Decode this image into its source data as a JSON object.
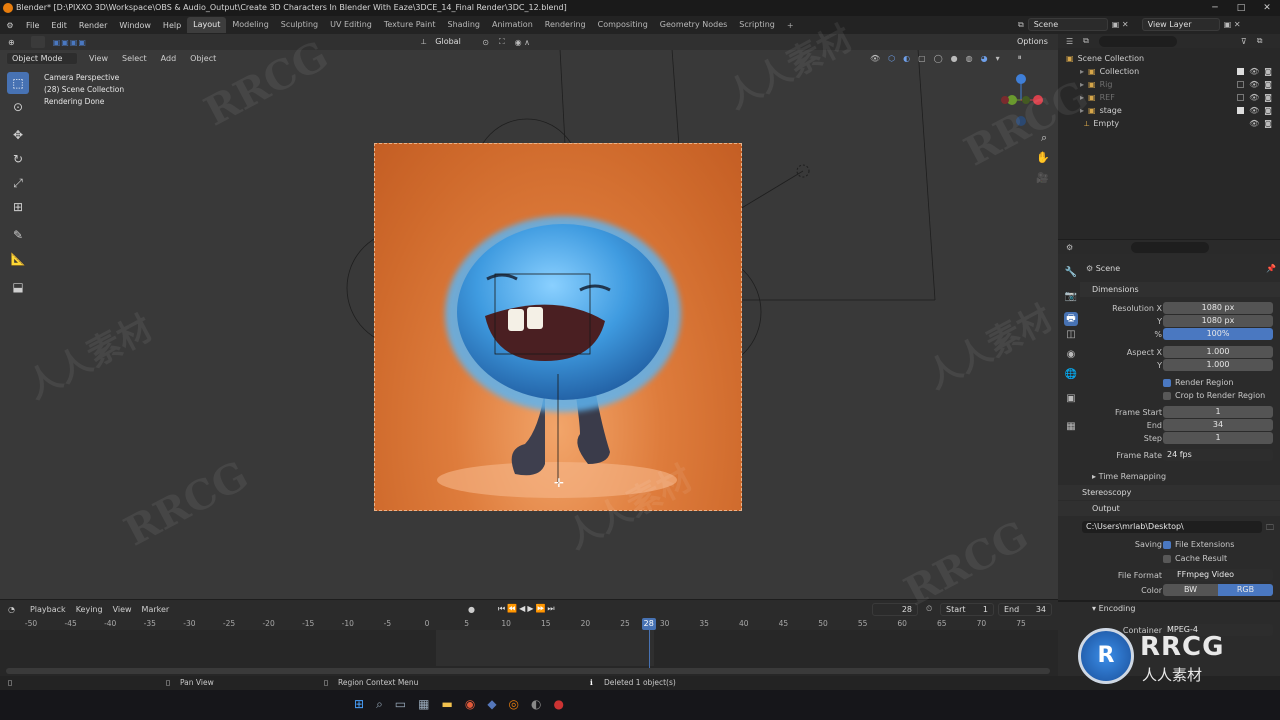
{
  "window": {
    "title": "Blender* [D:\\PIXXO 3D\\Workspace\\OBS & Audio_Output\\Create 3D Characters In Blender With Eaze\\3DCE_14_Final Render\\3DC_12.blend]"
  },
  "menu": [
    "File",
    "Edit",
    "Render",
    "Window",
    "Help"
  ],
  "workspaces": [
    "Layout",
    "Modeling",
    "Sculpting",
    "UV Editing",
    "Texture Paint",
    "Shading",
    "Animation",
    "Rendering",
    "Compositing",
    "Geometry Nodes",
    "Scripting"
  ],
  "scene_name": "Scene",
  "view_layer": "View Layer",
  "viewport": {
    "transform": "Global",
    "options": "Options",
    "mode": "Object Mode",
    "menus": [
      "View",
      "Select",
      "Add",
      "Object"
    ],
    "overlay_lines": [
      "Camera Perspective",
      "(28) Scene Collection",
      "Rendering Done"
    ]
  },
  "outliner": {
    "root": "Scene Collection",
    "items": [
      {
        "label": "Collection",
        "dim": false
      },
      {
        "label": "Rig",
        "dim": true
      },
      {
        "label": "REF",
        "dim": true
      },
      {
        "label": "stage",
        "dim": false
      },
      {
        "label": "Empty",
        "dim": false
      }
    ]
  },
  "properties": {
    "context": "Scene",
    "dimensions": "Dimensions",
    "res_x_label": "Resolution X",
    "res_x": "1080 px",
    "res_y_label": "Y",
    "res_y": "1080 px",
    "pct_label": "%",
    "pct": "100%",
    "aspect_x_label": "Aspect X",
    "aspect_x": "1.000",
    "aspect_y_label": "Y",
    "aspect_y": "1.000",
    "render_region": "Render Region",
    "crop_region": "Crop to Render Region",
    "frame_start_label": "Frame Start",
    "frame_start": "1",
    "end_label": "End",
    "end": "34",
    "step_label": "Step",
    "step": "1",
    "frame_rate_label": "Frame Rate",
    "frame_rate": "24 fps",
    "time_remapping": "Time Remapping",
    "stereoscopy": "Stereoscopy",
    "output": "Output",
    "output_path": "C:\\Users\\mrlab\\Desktop\\",
    "saving_label": "Saving",
    "file_extensions": "File Extensions",
    "cache_result": "Cache Result",
    "file_format_label": "File Format",
    "file_format": "FFmpeg Video",
    "color_label": "Color",
    "bw": "BW",
    "rgb": "RGB",
    "encoding": "Encoding",
    "container_label": "Container",
    "container": "MPEG-4"
  },
  "timeline": {
    "menus": [
      "Playback",
      "Keying",
      "View",
      "Marker"
    ],
    "current_frame": "28",
    "start_label": "Start",
    "start": "1",
    "end_label": "End",
    "end": "34",
    "ticks": [
      "-50",
      "-45",
      "-40",
      "-35",
      "-30",
      "-25",
      "-20",
      "-15",
      "-10",
      "-5",
      "0",
      "5",
      "10",
      "15",
      "20",
      "25",
      "30",
      "35",
      "40",
      "45",
      "50",
      "55",
      "60",
      "65",
      "70",
      "75"
    ],
    "playhead": "28"
  },
  "status": {
    "pan": "Pan View",
    "context": "Region Context Menu",
    "message": "Deleted 1 object(s)"
  },
  "watermarks": {
    "brand": "RRCG",
    "cn": "人人素材"
  },
  "colors": {
    "accent": "#4772b3",
    "orange": "#e87d0d",
    "creature": "#4aa8e8"
  }
}
